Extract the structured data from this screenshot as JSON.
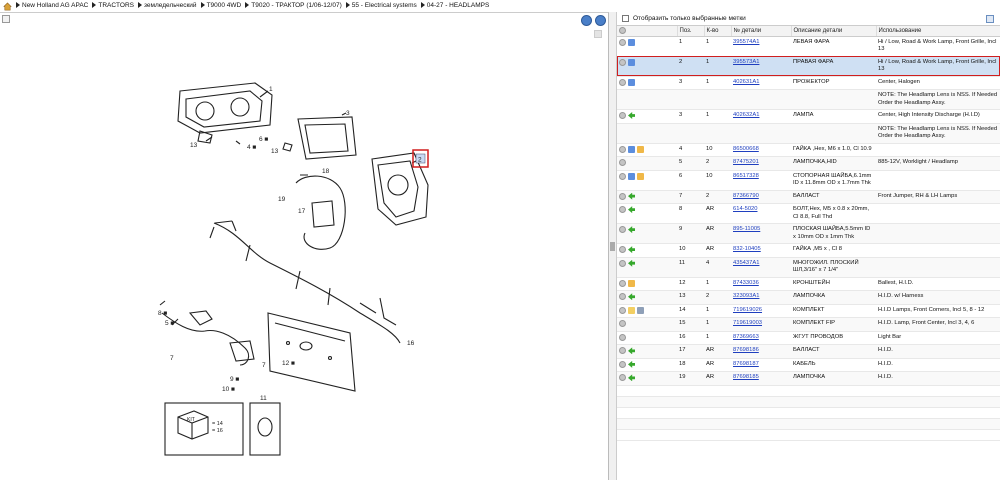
{
  "breadcrumb": [
    "New Holland AG APAC",
    "TRACTORS",
    "земледельческий",
    "T9000 4WD",
    "T9020 - ТРАКТОР (1/06-12/07)",
    "55 - Electrical systems",
    "04-27 - HEADLAMPS"
  ],
  "filter": {
    "label": "Отобразить только выбранные метки"
  },
  "columns": [
    "Поз.",
    "К-во",
    "№ детали",
    "Описание детали",
    "Использование"
  ],
  "rows": [
    {
      "pos": "1",
      "qty": "1",
      "part": "395574A1",
      "desc": "ЛЕВАЯ ФАРА",
      "usage": "Hi / Low, Road & Work Lamp, Front Grille, Incl 13",
      "icons": [
        "gray",
        "blue"
      ],
      "selected": false
    },
    {
      "pos": "2",
      "qty": "1",
      "part": "395573A1",
      "desc": "ПРАВАЯ ФАРА",
      "usage": "Hi / Low, Road & Work Lamp, Front Grille, Incl 13",
      "icons": [
        "gray",
        "blue"
      ],
      "selected": true
    },
    {
      "pos": "3",
      "qty": "1",
      "part": "402631A1",
      "desc": "ПРОЖЕКТОР",
      "usage": "Center, Halogen",
      "icons": [
        "gray",
        "blue"
      ],
      "selected": false
    },
    {
      "pos": "",
      "qty": "",
      "part": "",
      "desc": "",
      "usage": "NOTE: The Headlamp Lens is NSS. If Needed Order the Headlamp Assy.",
      "icons": [],
      "selected": false
    },
    {
      "pos": "3",
      "qty": "1",
      "part": "402632A1",
      "desc": "ЛАМПА",
      "usage": "Center, High Intensity Discharge (H.I.D)",
      "icons": [
        "gray",
        "green"
      ],
      "selected": false
    },
    {
      "pos": "",
      "qty": "",
      "part": "",
      "desc": "",
      "usage": "NOTE: The Headlamp Lens is NSS. If Needed Order the Headlamp Assy.",
      "icons": [],
      "selected": false
    },
    {
      "pos": "4",
      "qty": "10",
      "part": "86500668",
      "desc": "ГАЙКА ,Hex, M6 x 1.0, Cl 10.9",
      "usage": "",
      "icons": [
        "gray",
        "blue",
        "box"
      ],
      "selected": false
    },
    {
      "pos": "5",
      "qty": "2",
      "part": "87475201",
      "desc": "ЛАМПОЧКА,HID",
      "usage": "885-12V, Worklight / Headlamp",
      "icons": [
        "gray"
      ],
      "selected": false
    },
    {
      "pos": "6",
      "qty": "10",
      "part": "86517328",
      "desc": "СТОПОРНАЯ ШАЙБА,6.1mm ID x 11.8mm OD x 1.7mm Thk",
      "usage": "",
      "icons": [
        "gray",
        "blue",
        "box"
      ],
      "selected": false
    },
    {
      "pos": "7",
      "qty": "2",
      "part": "87366790",
      "desc": "БАЛЛАСТ",
      "usage": "Front Jumper, RH & LH Lamps",
      "icons": [
        "gray",
        "green"
      ],
      "selected": false
    },
    {
      "pos": "8",
      "qty": "AR",
      "part": "614-5020",
      "desc": "БОЛТ,Hex, M5 x 0.8 x 20mm, Cl 8.8, Full Thd",
      "usage": "",
      "icons": [
        "gray",
        "green"
      ],
      "selected": false
    },
    {
      "pos": "9",
      "qty": "AR",
      "part": "895-11005",
      "desc": "ПЛОСКАЯ ШАЙБА,5.5mm ID x 10mm OD x 1mm Thk",
      "usage": "",
      "icons": [
        "gray",
        "green"
      ],
      "selected": false
    },
    {
      "pos": "10",
      "qty": "AR",
      "part": "832-10405",
      "desc": "ГАЙКА ,M5 x , Cl 8",
      "usage": "",
      "icons": [
        "gray",
        "green"
      ],
      "selected": false
    },
    {
      "pos": "11",
      "qty": "4",
      "part": "435437A1",
      "desc": "МНОГОЖИЛ. ПЛОСКИЙ ШЛ,3/16\" x 7 1/4\"",
      "usage": "",
      "icons": [
        "gray",
        "green"
      ],
      "selected": false
    },
    {
      "pos": "12",
      "qty": "1",
      "part": "87433036",
      "desc": "КРОНШТЕЙН",
      "usage": "Ballest, H.I.D.",
      "icons": [
        "gray",
        "box"
      ],
      "selected": false
    },
    {
      "pos": "13",
      "qty": "2",
      "part": "323093A1",
      "desc": "ЛАМПОЧКА",
      "usage": "H.I.D. w/ Harness",
      "icons": [
        "gray",
        "green"
      ],
      "selected": false
    },
    {
      "pos": "14",
      "qty": "1",
      "part": "719619026",
      "desc": "КОМПЛЕКТ",
      "usage": "H.I.D Lamps, Front Corners, Incl 5, 8 - 12",
      "icons": [
        "gray",
        "folder",
        "tool"
      ],
      "selected": false
    },
    {
      "pos": "15",
      "qty": "1",
      "part": "719619003",
      "desc": "КОМПЛЕКТ FIP",
      "usage": "H.I.D. Lamp, Front Center, Incl 3, 4, 6",
      "icons": [
        "gray"
      ],
      "selected": false
    },
    {
      "pos": "16",
      "qty": "1",
      "part": "87369663",
      "desc": "ЖГУТ ПРОВОДОВ",
      "usage": "Light Bar",
      "icons": [
        "gray"
      ],
      "selected": false
    },
    {
      "pos": "17",
      "qty": "AR",
      "part": "87698186",
      "desc": "БАЛЛАСТ",
      "usage": "H.I.D.",
      "icons": [
        "gray",
        "green"
      ],
      "selected": false
    },
    {
      "pos": "18",
      "qty": "AR",
      "part": "87698187",
      "desc": "КАБЕЛЬ",
      "usage": "H.I.D.",
      "icons": [
        "gray",
        "green"
      ],
      "selected": false
    },
    {
      "pos": "19",
      "qty": "AR",
      "part": "87698185",
      "desc": "ЛАМПОЧКА",
      "usage": "H.I.D.",
      "icons": [
        "gray",
        "green"
      ],
      "selected": false
    }
  ],
  "diagram_callouts": [
    "1",
    "2",
    "3",
    "4",
    "5",
    "6",
    "7",
    "8",
    "9",
    "10",
    "11",
    "12",
    "13",
    "14",
    "16",
    "17",
    "18",
    "19"
  ],
  "kit_label": "KIT",
  "kit_legend": [
    "= 14",
    "= 16"
  ],
  "kit_callout": "11"
}
